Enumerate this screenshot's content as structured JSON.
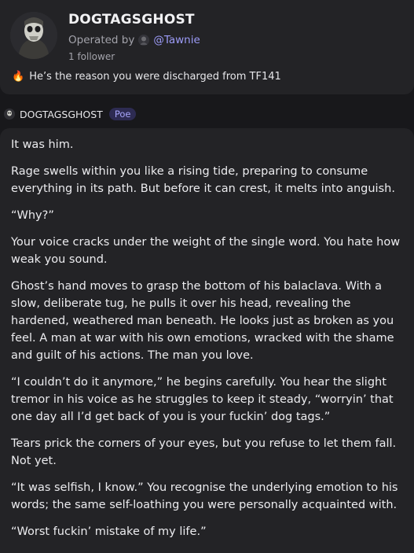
{
  "bot": {
    "name": "DOGTAGSGHOST",
    "operated_prefix": "Operated by",
    "operator_handle": "@Tawnie",
    "followers": "1 follower",
    "description_icon": "flame-icon",
    "description": "He’s the reason you were discharged from TF141"
  },
  "message": {
    "sender": "DOGTAGSGHOST",
    "badge": "Poe",
    "paragraphs": [
      "It was him.",
      "Rage swells within you like a rising tide, preparing to consume everything in its path. But before it can crest, it melts into anguish.",
      "“Why?”",
      "Your voice cracks under the weight of the single word. You hate how weak you sound.",
      "Ghost’s hand moves to grasp the bottom of his balaclava. With a slow, deliberate tug, he pulls it over his head, revealing the hardened, weathered man beneath. He looks just as broken as you feel. A man at war with his own emotions, wracked with the shame and guilt of his actions. The man you love.",
      "“I couldn’t do it anymore,” he begins carefully. You hear the slight tremor in his voice as he struggles to keep it steady, “worryin’ that one day all I’d get back of you is your fuckin’ dog tags.”",
      "Tears prick the corners of your eyes, but you refuse to let them fall. Not yet.",
      "“It was selfish, I know.” You recognise the underlying emotion to his words; the same self-loathing you were personally acquainted with.",
      "“Worst fuckin’ mistake of my life.”"
    ]
  },
  "colors": {
    "background": "#18181b",
    "card": "#232326",
    "accent": "#9c9bf7"
  }
}
